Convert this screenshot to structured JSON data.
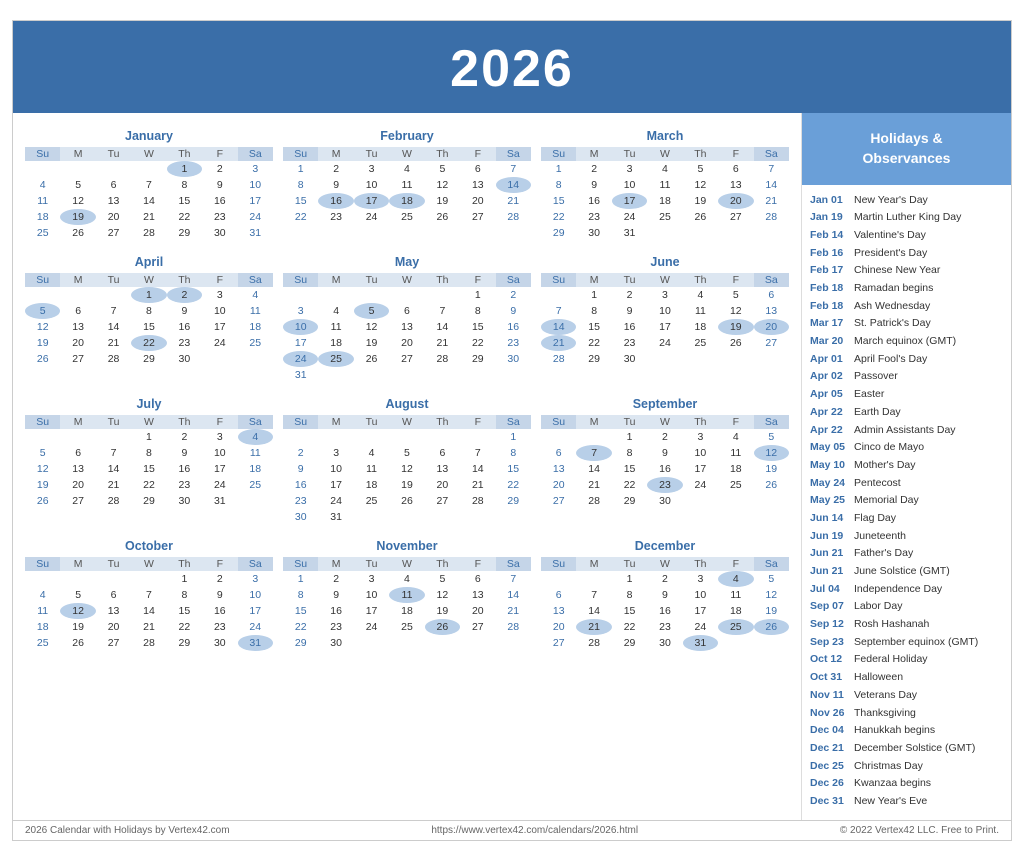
{
  "header": {
    "year": "2026"
  },
  "sidebar": {
    "title": "Holidays &\nObservances",
    "holidays": [
      {
        "date": "Jan 01",
        "name": "New Year's Day"
      },
      {
        "date": "Jan 19",
        "name": "Martin Luther King Day"
      },
      {
        "date": "Feb 14",
        "name": "Valentine's Day"
      },
      {
        "date": "Feb 16",
        "name": "President's Day"
      },
      {
        "date": "Feb 17",
        "name": "Chinese New Year"
      },
      {
        "date": "Feb 18",
        "name": "Ramadan begins"
      },
      {
        "date": "Feb 18",
        "name": "Ash Wednesday"
      },
      {
        "date": "Mar 17",
        "name": "St. Patrick's Day"
      },
      {
        "date": "Mar 20",
        "name": "March equinox (GMT)"
      },
      {
        "date": "Apr 01",
        "name": "April Fool's Day"
      },
      {
        "date": "Apr 02",
        "name": "Passover"
      },
      {
        "date": "Apr 05",
        "name": "Easter"
      },
      {
        "date": "Apr 22",
        "name": "Earth Day"
      },
      {
        "date": "Apr 22",
        "name": "Admin Assistants Day"
      },
      {
        "date": "May 05",
        "name": "Cinco de Mayo"
      },
      {
        "date": "May 10",
        "name": "Mother's Day"
      },
      {
        "date": "May 24",
        "name": "Pentecost"
      },
      {
        "date": "May 25",
        "name": "Memorial Day"
      },
      {
        "date": "Jun 14",
        "name": "Flag Day"
      },
      {
        "date": "Jun 19",
        "name": "Juneteenth"
      },
      {
        "date": "Jun 21",
        "name": "Father's Day"
      },
      {
        "date": "Jun 21",
        "name": "June Solstice (GMT)"
      },
      {
        "date": "Jul 04",
        "name": "Independence Day"
      },
      {
        "date": "Sep 07",
        "name": "Labor Day"
      },
      {
        "date": "Sep 12",
        "name": "Rosh Hashanah"
      },
      {
        "date": "Sep 23",
        "name": "September equinox (GMT)"
      },
      {
        "date": "Oct 12",
        "name": "Federal Holiday"
      },
      {
        "date": "Oct 31",
        "name": "Halloween"
      },
      {
        "date": "Nov 11",
        "name": "Veterans Day"
      },
      {
        "date": "Nov 26",
        "name": "Thanksgiving"
      },
      {
        "date": "Dec 04",
        "name": "Hanukkah begins"
      },
      {
        "date": "Dec 21",
        "name": "December Solstice (GMT)"
      },
      {
        "date": "Dec 25",
        "name": "Christmas Day"
      },
      {
        "date": "Dec 26",
        "name": "Kwanzaa begins"
      },
      {
        "date": "Dec 31",
        "name": "New Year's Eve"
      }
    ]
  },
  "footer": {
    "left": "2026 Calendar with Holidays by Vertex42.com",
    "center": "https://www.vertex42.com/calendars/2026.html",
    "right": "© 2022 Vertex42 LLC. Free to Print."
  },
  "months": [
    {
      "name": "January",
      "weeks": [
        [
          null,
          null,
          null,
          null,
          "1",
          "2",
          "3"
        ],
        [
          "4",
          "5",
          "6",
          "7",
          "8",
          "9",
          "10"
        ],
        [
          "11",
          "12",
          "13",
          "14",
          "15",
          "16",
          "17"
        ],
        [
          "18",
          "19",
          "20",
          "21",
          "22",
          "23",
          "24"
        ],
        [
          "25",
          "26",
          "27",
          "28",
          "29",
          "30",
          "31"
        ]
      ],
      "highlighted": [
        "1",
        "19"
      ],
      "special": []
    },
    {
      "name": "February",
      "weeks": [
        [
          "1",
          "2",
          "3",
          "4",
          "5",
          "6",
          "7"
        ],
        [
          "8",
          "9",
          "10",
          "11",
          "12",
          "13",
          "14"
        ],
        [
          "15",
          "16",
          "17",
          "18",
          "19",
          "20",
          "21"
        ],
        [
          "22",
          "23",
          "24",
          "25",
          "26",
          "27",
          "28"
        ]
      ],
      "highlighted": [
        "14",
        "16",
        "17",
        "18"
      ],
      "special": []
    },
    {
      "name": "March",
      "weeks": [
        [
          "1",
          "2",
          "3",
          "4",
          "5",
          "6",
          "7"
        ],
        [
          "8",
          "9",
          "10",
          "11",
          "12",
          "13",
          "14"
        ],
        [
          "15",
          "16",
          "17",
          "18",
          "19",
          "20",
          "21"
        ],
        [
          "22",
          "23",
          "24",
          "25",
          "26",
          "27",
          "28"
        ],
        [
          "29",
          "30",
          "31",
          null,
          null,
          null,
          null
        ]
      ],
      "highlighted": [
        "17",
        "20"
      ],
      "special": []
    },
    {
      "name": "April",
      "weeks": [
        [
          null,
          null,
          null,
          "1",
          "2",
          "3",
          "4"
        ],
        [
          "5",
          "6",
          "7",
          "8",
          "9",
          "10",
          "11"
        ],
        [
          "12",
          "13",
          "14",
          "15",
          "16",
          "17",
          "18"
        ],
        [
          "19",
          "20",
          "21",
          "22",
          "23",
          "24",
          "25"
        ],
        [
          "26",
          "27",
          "28",
          "29",
          "30",
          null,
          null
        ]
      ],
      "highlighted": [
        "1",
        "2",
        "5",
        "22"
      ],
      "special": []
    },
    {
      "name": "May",
      "weeks": [
        [
          null,
          null,
          null,
          null,
          null,
          "1",
          "2"
        ],
        [
          "3",
          "4",
          "5",
          "6",
          "7",
          "8",
          "9"
        ],
        [
          "10",
          "11",
          "12",
          "13",
          "14",
          "15",
          "16"
        ],
        [
          "17",
          "18",
          "19",
          "20",
          "21",
          "22",
          "23"
        ],
        [
          "24",
          "25",
          "26",
          "27",
          "28",
          "29",
          "30"
        ],
        [
          "31",
          null,
          null,
          null,
          null,
          null,
          null
        ]
      ],
      "highlighted": [
        "5",
        "10",
        "24",
        "25"
      ],
      "special": []
    },
    {
      "name": "June",
      "weeks": [
        [
          null,
          "1",
          "2",
          "3",
          "4",
          "5",
          "6"
        ],
        [
          "7",
          "8",
          "9",
          "10",
          "11",
          "12",
          "13"
        ],
        [
          "14",
          "15",
          "16",
          "17",
          "18",
          "19",
          "20"
        ],
        [
          "21",
          "22",
          "23",
          "24",
          "25",
          "26",
          "27"
        ],
        [
          "28",
          "29",
          "30",
          null,
          null,
          null,
          null
        ]
      ],
      "highlighted": [
        "14",
        "19",
        "20",
        "21"
      ],
      "special": []
    },
    {
      "name": "July",
      "weeks": [
        [
          null,
          null,
          null,
          "1",
          "2",
          "3",
          "4"
        ],
        [
          "5",
          "6",
          "7",
          "8",
          "9",
          "10",
          "11"
        ],
        [
          "12",
          "13",
          "14",
          "15",
          "16",
          "17",
          "18"
        ],
        [
          "19",
          "20",
          "21",
          "22",
          "23",
          "24",
          "25"
        ],
        [
          "26",
          "27",
          "28",
          "29",
          "30",
          "31",
          null
        ]
      ],
      "highlighted": [
        "4"
      ],
      "special": []
    },
    {
      "name": "August",
      "weeks": [
        [
          null,
          null,
          null,
          null,
          null,
          null,
          "1"
        ],
        [
          "2",
          "3",
          "4",
          "5",
          "6",
          "7",
          "8"
        ],
        [
          "9",
          "10",
          "11",
          "12",
          "13",
          "14",
          "15"
        ],
        [
          "16",
          "17",
          "18",
          "19",
          "20",
          "21",
          "22"
        ],
        [
          "23",
          "24",
          "25",
          "26",
          "27",
          "28",
          "29"
        ],
        [
          "30",
          "31",
          null,
          null,
          null,
          null,
          null
        ]
      ],
      "highlighted": [],
      "special": []
    },
    {
      "name": "September",
      "weeks": [
        [
          null,
          null,
          "1",
          "2",
          "3",
          "4",
          "5"
        ],
        [
          "6",
          "7",
          "8",
          "9",
          "10",
          "11",
          "12"
        ],
        [
          "13",
          "14",
          "15",
          "16",
          "17",
          "18",
          "19"
        ],
        [
          "20",
          "21",
          "22",
          "23",
          "24",
          "25",
          "26"
        ],
        [
          "27",
          "28",
          "29",
          "30",
          null,
          null,
          null
        ]
      ],
      "highlighted": [
        "7",
        "12",
        "23"
      ],
      "special": []
    },
    {
      "name": "October",
      "weeks": [
        [
          null,
          null,
          null,
          null,
          "1",
          "2",
          "3"
        ],
        [
          "4",
          "5",
          "6",
          "7",
          "8",
          "9",
          "10"
        ],
        [
          "11",
          "12",
          "13",
          "14",
          "15",
          "16",
          "17"
        ],
        [
          "18",
          "19",
          "20",
          "21",
          "22",
          "23",
          "24"
        ],
        [
          "25",
          "26",
          "27",
          "28",
          "29",
          "30",
          "31"
        ]
      ],
      "highlighted": [
        "12",
        "31"
      ],
      "special": []
    },
    {
      "name": "November",
      "weeks": [
        [
          "1",
          "2",
          "3",
          "4",
          "5",
          "6",
          "7"
        ],
        [
          "8",
          "9",
          "10",
          "11",
          "12",
          "13",
          "14"
        ],
        [
          "15",
          "16",
          "17",
          "18",
          "19",
          "20",
          "21"
        ],
        [
          "22",
          "23",
          "24",
          "25",
          "26",
          "27",
          "28"
        ],
        [
          "29",
          "30",
          null,
          null,
          null,
          null,
          null
        ]
      ],
      "highlighted": [
        "11",
        "26"
      ],
      "special": []
    },
    {
      "name": "December",
      "weeks": [
        [
          null,
          null,
          "1",
          "2",
          "3",
          "4",
          "5"
        ],
        [
          "6",
          "7",
          "8",
          "9",
          "10",
          "11",
          "12"
        ],
        [
          "13",
          "14",
          "15",
          "16",
          "17",
          "18",
          "19"
        ],
        [
          "20",
          "21",
          "22",
          "23",
          "24",
          "25",
          "26"
        ],
        [
          "27",
          "28",
          "29",
          "30",
          "31",
          null,
          null
        ]
      ],
      "highlighted": [
        "4",
        "21",
        "25",
        "26",
        "31"
      ],
      "special": []
    }
  ]
}
